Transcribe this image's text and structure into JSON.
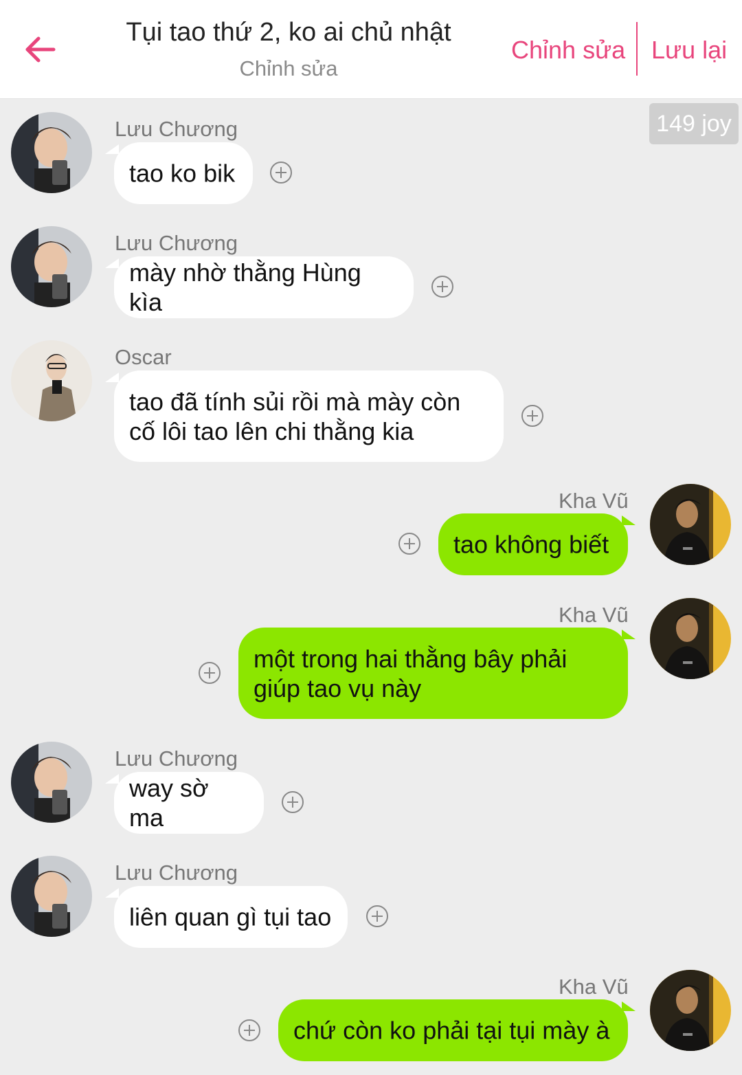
{
  "header": {
    "title": "Tụi tao thứ 2, ko ai chủ nhật",
    "subtitle": "Chỉnh sửa",
    "edit_label": "Chỉnh sửa",
    "save_label": "Lưu lại",
    "accent_color": "#e8457c"
  },
  "joy_badge": "149 joy",
  "colors": {
    "background": "#ededed",
    "bubble_left": "#ffffff",
    "bubble_right": "#8ce600"
  },
  "messages": [
    {
      "sender": "Lưu Chương",
      "side": "left",
      "text": "tao ko bik"
    },
    {
      "sender": "Lưu Chương",
      "side": "left",
      "text": "mày nhờ thằng Hùng kìa"
    },
    {
      "sender": "Oscar",
      "side": "left",
      "text": "tao đã tính sủi rồi mà mày còn cố lôi tao lên chi thằng kia"
    },
    {
      "sender": "Kha Vũ",
      "side": "right",
      "text": "tao không biết"
    },
    {
      "sender": "Kha Vũ",
      "side": "right",
      "text": "một trong hai thằng bây phải giúp tao vụ này"
    },
    {
      "sender": "Lưu Chương",
      "side": "left",
      "text": "way sờ ma"
    },
    {
      "sender": "Lưu Chương",
      "side": "left",
      "text": "liên quan gì tụi tao"
    },
    {
      "sender": "Kha Vũ",
      "side": "right",
      "text": "chứ còn ko phải tại tụi mày à"
    }
  ]
}
